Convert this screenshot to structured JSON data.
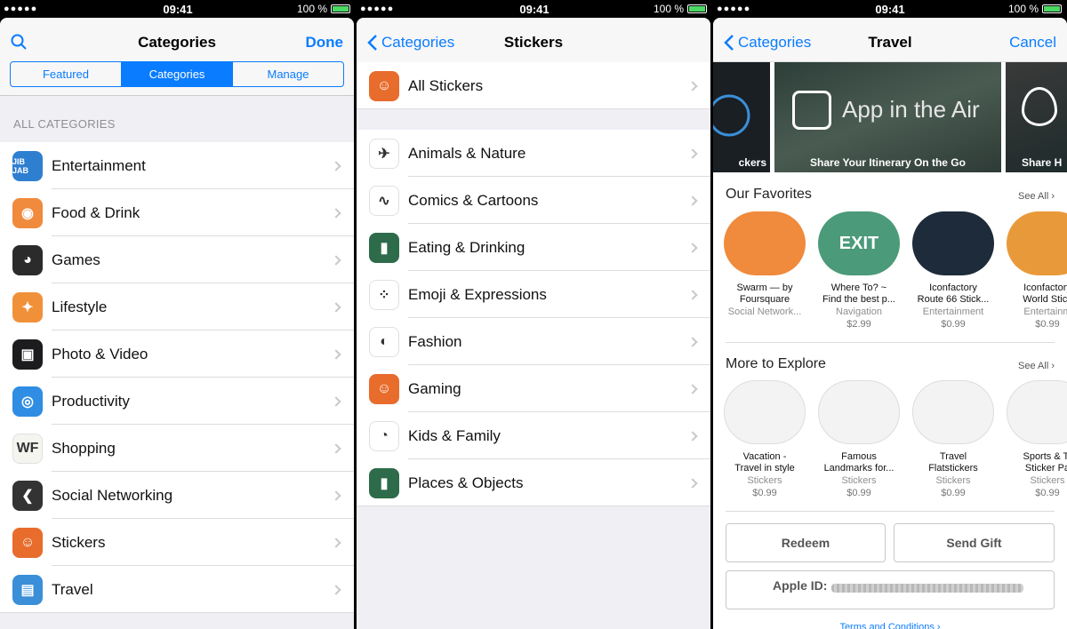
{
  "status": {
    "signal": "●●●●●",
    "time": "09:41",
    "battery": "100 %"
  },
  "panel1": {
    "title": "Categories",
    "done": "Done",
    "segments": [
      "Featured",
      "Categories",
      "Manage"
    ],
    "active_segment": 1,
    "section": "ALL CATEGORIES",
    "items": [
      {
        "label": "Entertainment",
        "icon": "jibjab-icon",
        "glyph": "JIB JAB",
        "color": "#2f7fd1"
      },
      {
        "label": "Food & Drink",
        "icon": "food-icon",
        "glyph": "◉",
        "color": "#f08a3c"
      },
      {
        "label": "Games",
        "icon": "gamepad-icon",
        "glyph": "◕",
        "color": "#2b2b2b"
      },
      {
        "label": "Lifestyle",
        "icon": "lifestyle-icon",
        "glyph": "✦",
        "color": "#f0913a"
      },
      {
        "label": "Photo & Video",
        "icon": "photo-icon",
        "glyph": "▣",
        "color": "#1c1c1e"
      },
      {
        "label": "Productivity",
        "icon": "globe-icon",
        "glyph": "◎",
        "color": "#2f8de4"
      },
      {
        "label": "Shopping",
        "icon": "wf-icon",
        "glyph": "WF",
        "color": "#f5f5f0"
      },
      {
        "label": "Social Networking",
        "icon": "swarm-icon",
        "glyph": "❮",
        "color": "#333333"
      },
      {
        "label": "Stickers",
        "icon": "mario-icon",
        "glyph": "☺",
        "color": "#e86c2c"
      },
      {
        "label": "Travel",
        "icon": "luggage-icon",
        "glyph": "▤",
        "color": "#3a8fd8"
      }
    ]
  },
  "panel2": {
    "back": "Categories",
    "title": "Stickers",
    "top_item": {
      "label": "All Stickers",
      "icon": "mario-icon",
      "glyph": "☺",
      "color": "#e86c2c"
    },
    "items": [
      {
        "label": "Animals & Nature",
        "icon": "bird-icon",
        "glyph": "✈",
        "color": "#ffffff"
      },
      {
        "label": "Comics & Cartoons",
        "icon": "comic-icon",
        "glyph": "∿",
        "color": "#ffffff"
      },
      {
        "label": "Eating & Drinking",
        "icon": "cup-icon",
        "glyph": "▮",
        "color": "#2e6b4a"
      },
      {
        "label": "Emoji & Expressions",
        "icon": "dots-icon",
        "glyph": "⁘",
        "color": "#ffffff"
      },
      {
        "label": "Fashion",
        "icon": "fashion-icon",
        "glyph": "◐",
        "color": "#ffffff"
      },
      {
        "label": "Gaming",
        "icon": "mario-icon",
        "glyph": "☺",
        "color": "#e86c2c"
      },
      {
        "label": "Kids & Family",
        "icon": "corgi-icon",
        "glyph": "◔",
        "color": "#ffffff"
      },
      {
        "label": "Places & Objects",
        "icon": "cup-icon",
        "glyph": "▮",
        "color": "#2e6b4a"
      }
    ]
  },
  "panel3": {
    "back": "Categories",
    "title": "Travel",
    "cancel": "Cancel",
    "banners": [
      {
        "caption": "ckers"
      },
      {
        "caption": "Share Your Itinerary On the Go",
        "text": "App in the Air"
      },
      {
        "caption": "Share H"
      }
    ],
    "favorites_title": "Our Favorites",
    "see_all": "See All",
    "favorites": [
      {
        "name1": "Swarm — by",
        "name2": "Foursquare",
        "cat": "Social Network...",
        "price": "",
        "icon": "swarm-icon",
        "color": "#f08a3c"
      },
      {
        "name1": "Where To? ~",
        "name2": "Find the best p...",
        "cat": "Navigation",
        "price": "$2.99",
        "icon": "exit-sign-icon",
        "color": "#4b9a7a",
        "glyph": "EXIT"
      },
      {
        "name1": "Iconfactory",
        "name2": "Route 66 Stick...",
        "cat": "Entertainment",
        "price": "$0.99",
        "icon": "route66-icon",
        "color": "#1d2b3a"
      },
      {
        "name1": "Iconfactory",
        "name2": "World Stick",
        "cat": "Entertainm",
        "price": "$0.99",
        "icon": "burger-icon",
        "color": "#e89a3a"
      }
    ],
    "explore_title": "More to Explore",
    "explore": [
      {
        "name1": "Vacation -",
        "name2": "Travel in style",
        "cat": "Stickers",
        "price": "$0.99",
        "icon": "palm-tree-icon",
        "color": "#f3f3f3"
      },
      {
        "name1": "Famous",
        "name2": "Landmarks for...",
        "cat": "Stickers",
        "price": "$0.99",
        "icon": "landmarks-icon",
        "color": "#f3f3f3"
      },
      {
        "name1": "Travel",
        "name2": "Flatstickers",
        "cat": "Stickers",
        "price": "$0.99",
        "icon": "buggy-icon",
        "color": "#f3f3f3"
      },
      {
        "name1": "Sports & Tr",
        "name2": "Sticker Pa",
        "cat": "Stickers",
        "price": "$0.99",
        "icon": "bicycle-icon",
        "color": "#f3f3f3"
      }
    ],
    "redeem": "Redeem",
    "send_gift": "Send Gift",
    "apple_id": "Apple ID:",
    "terms": "Terms and Conditions"
  }
}
